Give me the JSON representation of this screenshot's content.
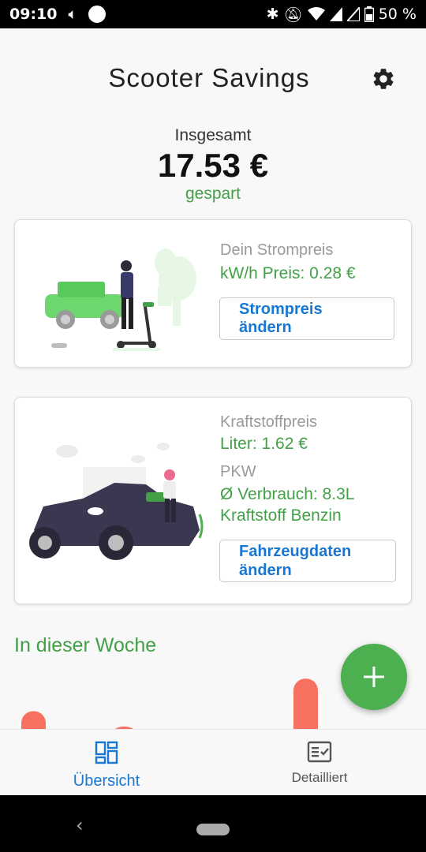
{
  "status": {
    "time": "09:10",
    "battery": "50 %"
  },
  "header": {
    "title": "Scooter Savings"
  },
  "summary": {
    "label": "Insgesamt",
    "amount": "17.53 €",
    "sub": "gespart"
  },
  "electricity_card": {
    "label": "Dein Strompreis",
    "price": "kW/h Preis: 0.28 €",
    "button": "Strompreis ändern"
  },
  "fuel_card": {
    "label": "Kraftstoffpreis",
    "price": "Liter:  1.62 €",
    "vehicle_type": "PKW",
    "consumption": "Ø Verbrauch: 8.3L",
    "fuel": "Kraftstoff Benzin",
    "button": "Fahrzeugdaten ändern"
  },
  "week": {
    "title": "In dieser Woche",
    "bar_color": "#f87060",
    "bars": [
      0.3,
      0.02,
      0.0,
      0.85,
      0.0,
      0.0
    ]
  },
  "nav": {
    "overview": "Übersicht",
    "detail": "Detailliert"
  },
  "colors": {
    "accent_green": "#43a047",
    "fab_green": "#4caf50",
    "link_blue": "#1976d2"
  }
}
